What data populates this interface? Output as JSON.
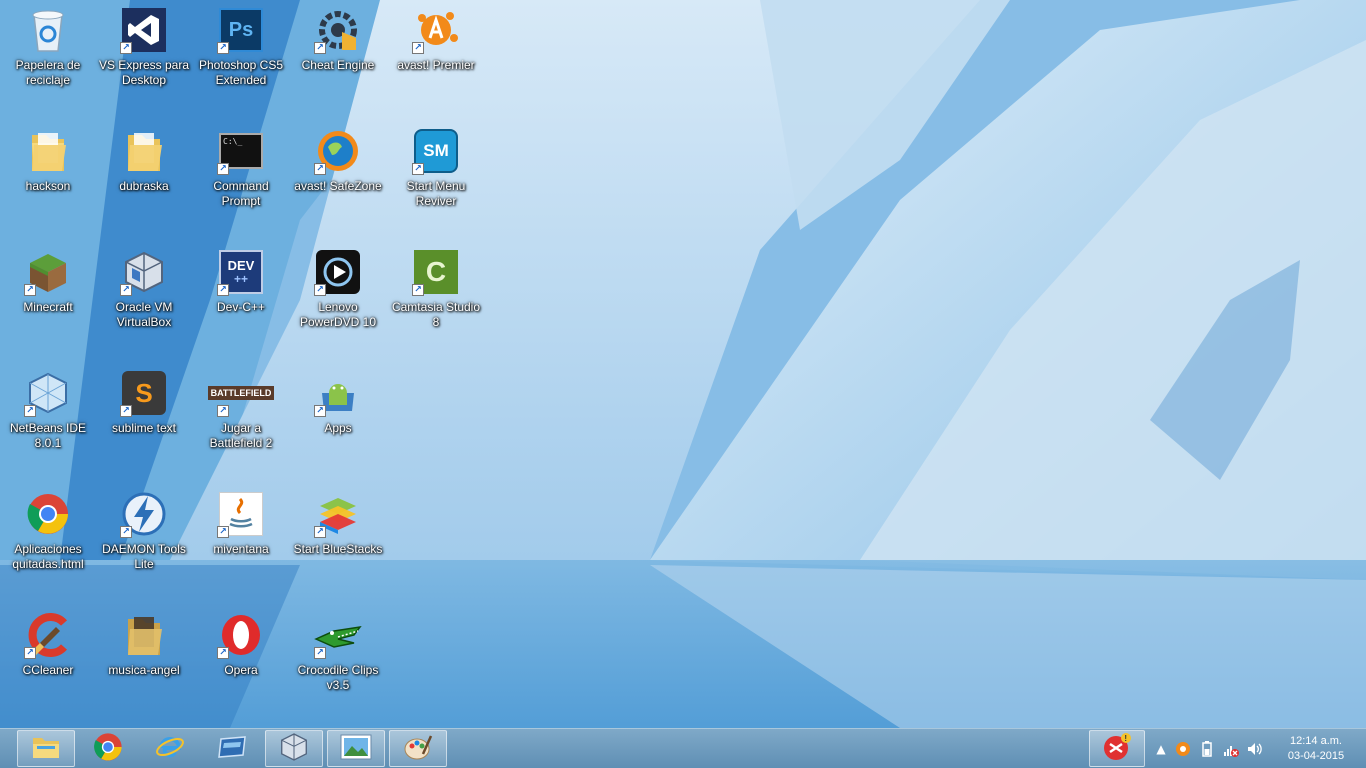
{
  "desktop": {
    "icons": [
      {
        "label": "Papelera de reciclaje",
        "icon": "recycle-bin-icon"
      },
      {
        "label": "VS Express para Desktop",
        "icon": "visual-studio-icon"
      },
      {
        "label": "Photoshop CS5 Extended",
        "icon": "photoshop-icon"
      },
      {
        "label": "Cheat Engine",
        "icon": "cheat-engine-icon"
      },
      {
        "label": "avast! Premier",
        "icon": "avast-icon"
      },
      {
        "label": "hackson",
        "icon": "folder-icon"
      },
      {
        "label": "dubraska",
        "icon": "folder-icon"
      },
      {
        "label": "Command Prompt",
        "icon": "command-prompt-icon"
      },
      {
        "label": "avast! SafeZone",
        "icon": "avast-safezone-icon"
      },
      {
        "label": "Start Menu Reviver",
        "icon": "start-menu-reviver-icon"
      },
      {
        "label": "Minecraft",
        "icon": "minecraft-icon"
      },
      {
        "label": "Oracle VM VirtualBox",
        "icon": "virtualbox-icon"
      },
      {
        "label": "Dev-C++",
        "icon": "dev-cpp-icon"
      },
      {
        "label": "Lenovo PowerDVD 10",
        "icon": "powerdvd-icon"
      },
      {
        "label": "Camtasia Studio 8",
        "icon": "camtasia-icon"
      },
      {
        "label": "NetBeans IDE 8.0.1",
        "icon": "netbeans-icon"
      },
      {
        "label": "sublime text",
        "icon": "sublime-text-icon"
      },
      {
        "label": "Jugar a Battlefield 2",
        "icon": "battlefield-icon"
      },
      {
        "label": "Apps",
        "icon": "android-apps-icon"
      },
      {
        "label": "Aplicaciones quitadas.html",
        "icon": "chrome-icon"
      },
      {
        "label": "DAEMON Tools Lite",
        "icon": "daemon-tools-icon"
      },
      {
        "label": "miventana",
        "icon": "java-icon"
      },
      {
        "label": "Start BlueStacks",
        "icon": "bluestacks-icon"
      },
      {
        "label": "CCleaner",
        "icon": "ccleaner-icon"
      },
      {
        "label": "musica-angel",
        "icon": "folder-icon"
      },
      {
        "label": "Opera",
        "icon": "opera-icon"
      },
      {
        "label": "Crocodile Clips v3.5",
        "icon": "crocodile-clips-icon"
      }
    ]
  },
  "taskbar": {
    "pinned": [
      {
        "icon": "file-explorer-icon",
        "active": true
      },
      {
        "icon": "chrome-icon",
        "active": false
      },
      {
        "icon": "internet-explorer-icon",
        "active": false
      },
      {
        "icon": "desktop-app-icon",
        "active": false
      },
      {
        "icon": "virtualbox-icon",
        "active": true
      },
      {
        "icon": "photo-viewer-icon",
        "active": true
      },
      {
        "icon": "paint-icon",
        "active": true
      }
    ],
    "tray": {
      "notification_app": "notification-app-icon",
      "icons": [
        "show-hidden-icons-icon",
        "avast-tray-icon",
        "battery-icon",
        "network-error-icon",
        "volume-icon"
      ]
    },
    "clock": {
      "time": "12:14 a.m.",
      "date": "03-04-2015"
    }
  }
}
